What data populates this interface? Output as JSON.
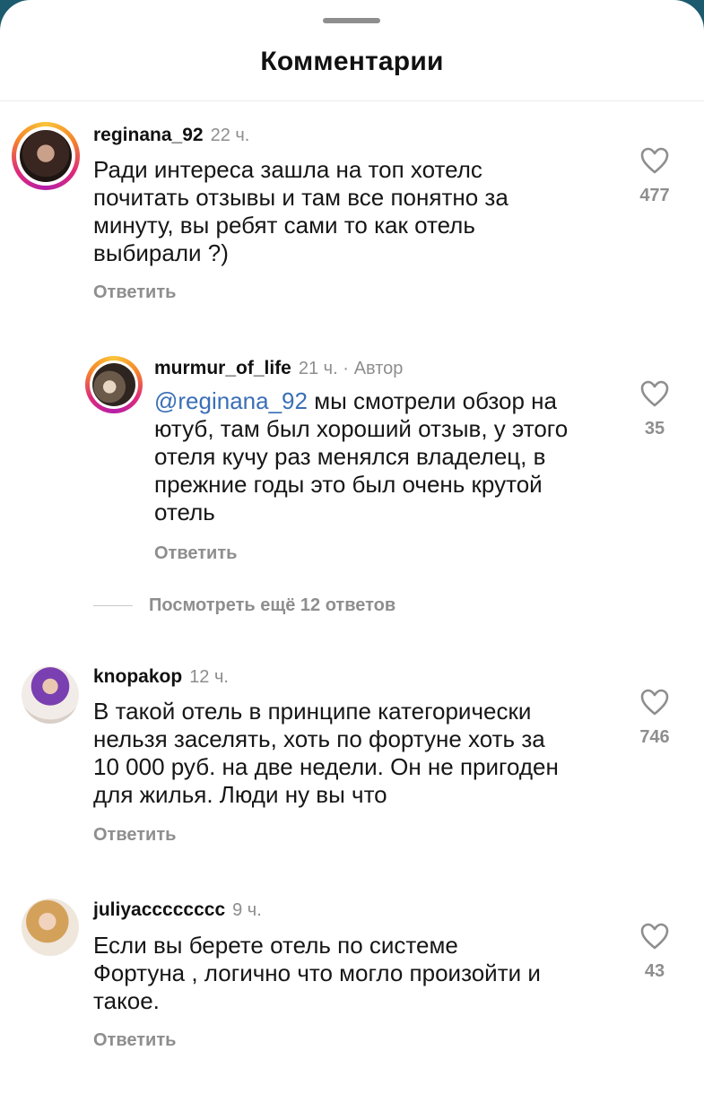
{
  "sheet": {
    "title": "Комментарии"
  },
  "comments": [
    {
      "user": "reginana_92",
      "time": "22 ч.",
      "lines": [
        "Ради интереса зашла на топ хотелс",
        "почитать отзывы и там все понятно за",
        "минуту, вы ребят сами то как отель",
        "выбирали ?)"
      ],
      "reply_label": "Ответить",
      "likes": "477",
      "avatar_icon": "avatar-story-ring"
    },
    {
      "user": "murmur_of_life",
      "time": "21 ч. ·",
      "author_badge": "Автор",
      "mention": "@reginana_92",
      "lines": [
        " мы смотрели обзор на",
        "ютуб, там был хороший отзыв, у этого",
        "отеля кучу раз менялся владелец, в",
        "прежние годы это был очень крутой",
        "отель"
      ],
      "reply_label": "Ответить",
      "likes": "35",
      "avatar_icon": "avatar-story-ring"
    },
    {
      "user": "knopakop",
      "time": "12 ч.",
      "lines": [
        "В такой отель в принципе категорически",
        "нельзя заселять, хоть по фортуне хоть за",
        "10 000 руб. на две недели. Он не пригоден",
        "для жилья. Люди ну вы что"
      ],
      "reply_label": "Ответить",
      "likes": "746",
      "avatar_icon": "avatar"
    },
    {
      "user": "juliyacccccccc",
      "time": "9 ч.",
      "lines": [
        "Если вы берете отель по системе",
        "Фортуна , логично что могло произойти и",
        "такое."
      ],
      "reply_label": "Ответить",
      "likes": "43",
      "avatar_icon": "avatar"
    }
  ],
  "view_more": {
    "label": "Посмотреть ещё 12 ответов"
  },
  "icons": {
    "like": "heart-outline-icon"
  },
  "colors": {
    "mention": "#3a6fb6",
    "muted": "#8e8e8e",
    "background_edge": "#1c5a6e"
  }
}
